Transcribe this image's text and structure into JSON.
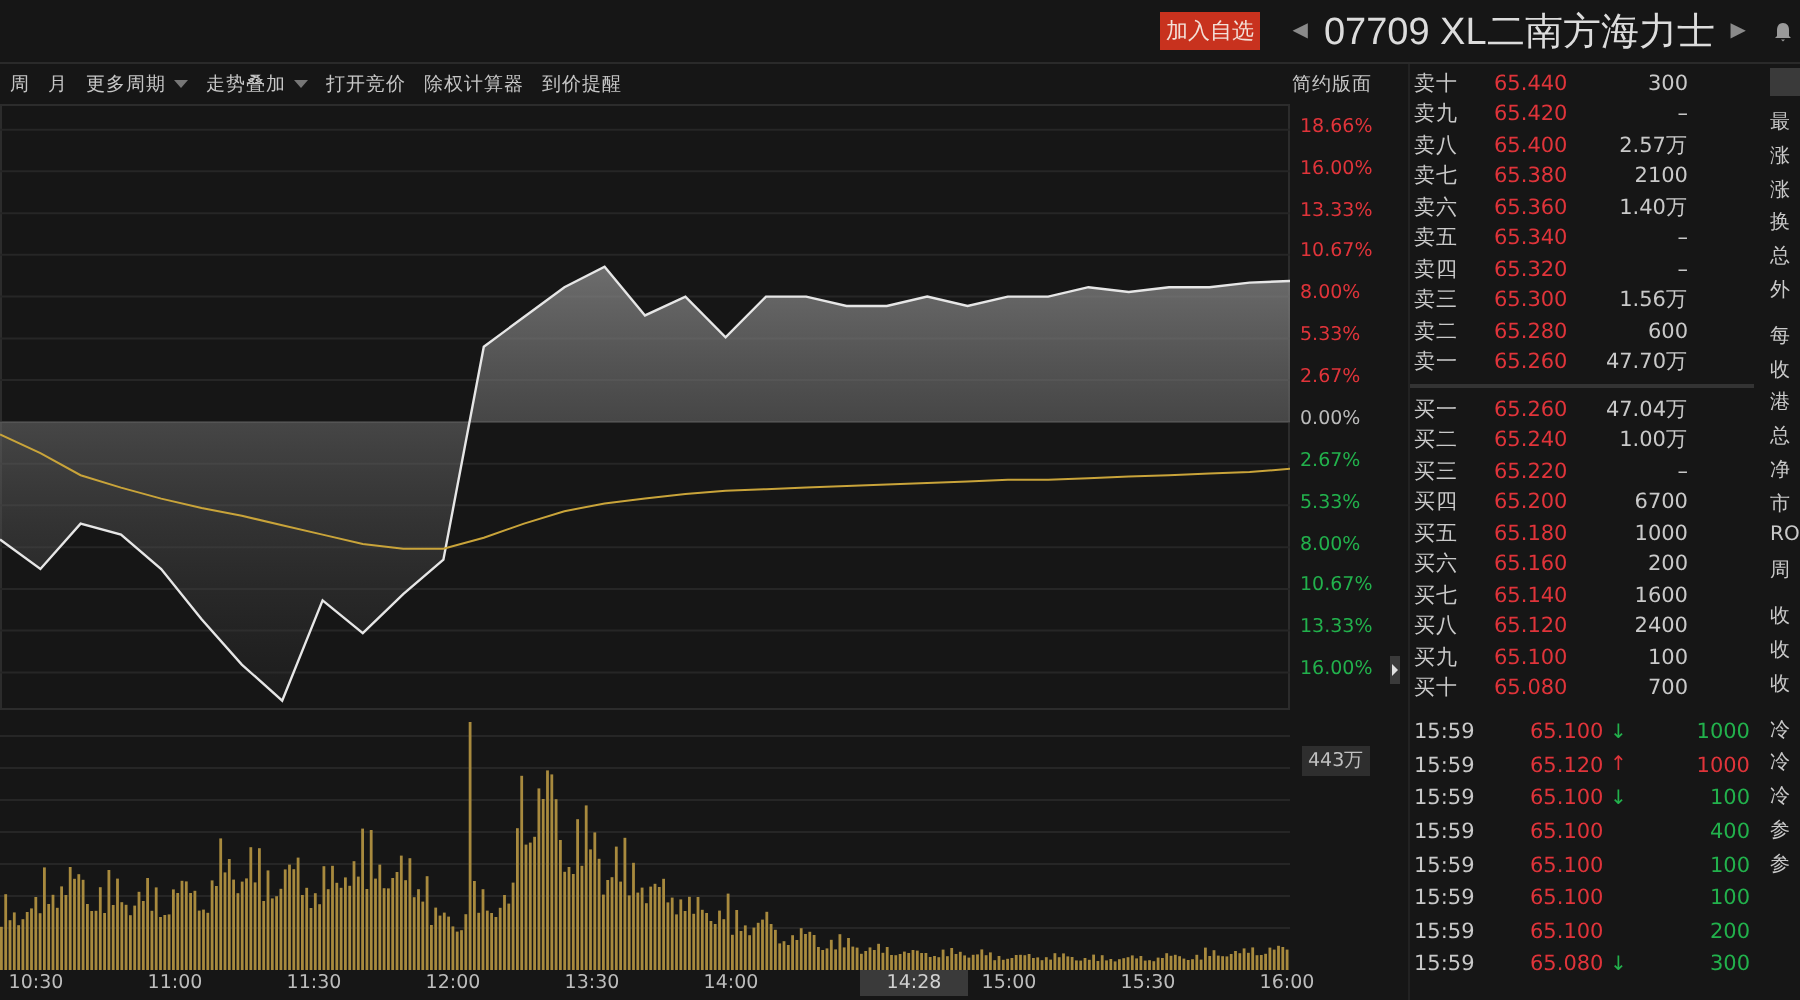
{
  "header": {
    "watch_button": "加入自选",
    "prev": "◀",
    "title": "07709 XL二南方海力士",
    "next": "▶"
  },
  "toolbar": {
    "items": [
      {
        "label": "周",
        "dropdown": false
      },
      {
        "label": "月",
        "dropdown": false
      },
      {
        "label": "更多周期",
        "dropdown": true
      },
      {
        "label": "走势叠加",
        "dropdown": true
      },
      {
        "label": "打开竞价",
        "dropdown": false
      },
      {
        "label": "除权计算器",
        "dropdown": false
      },
      {
        "label": "到价提醒",
        "dropdown": false
      }
    ],
    "layout_toggle": "简约版面"
  },
  "price_chart": {
    "chart_data": {
      "type": "area",
      "grid": true,
      "ylim": [
        -18.4,
        20.3
      ],
      "yticks": [
        {
          "value": 18.66,
          "label": "18.66%"
        },
        {
          "value": 16,
          "label": "16.00%"
        },
        {
          "value": 13.33,
          "label": "13.33%"
        },
        {
          "value": 10.67,
          "label": "10.67%"
        },
        {
          "value": 8,
          "label": "8.00%"
        },
        {
          "value": 5.33,
          "label": "5.33%"
        },
        {
          "value": 2.67,
          "label": "2.67%"
        },
        {
          "value": 0,
          "label": "0.00%"
        },
        {
          "value": -2.67,
          "label": "2.67%"
        },
        {
          "value": -5.33,
          "label": "5.33%"
        },
        {
          "value": -8,
          "label": "8.00%"
        },
        {
          "value": -10.67,
          "label": "10.67%"
        },
        {
          "value": -13.33,
          "label": "13.33%"
        },
        {
          "value": -16,
          "label": "16.00%"
        }
      ],
      "series": [
        {
          "type": "area",
          "color": "#e6e6e6",
          "values": [
            -7.5,
            -9.4,
            -6.5,
            -7.2,
            -9.4,
            -12.6,
            -15.5,
            -17.8,
            -11.4,
            -13.5,
            -11.0,
            -8.8,
            4.8,
            6.7,
            8.6,
            9.9,
            6.8,
            8.0,
            5.4,
            8.0,
            8.0,
            7.4,
            7.4,
            8.0,
            7.4,
            8.0,
            8.0,
            8.6,
            8.3,
            8.6,
            8.6,
            8.9,
            9.0
          ]
        },
        {
          "type": "line",
          "color": "#c9a43a",
          "values": [
            -0.8,
            -2.0,
            -3.4,
            -4.2,
            -4.9,
            -5.5,
            -6.0,
            -6.6,
            -7.2,
            -7.8,
            -8.1,
            -8.1,
            -7.4,
            -6.5,
            -5.7,
            -5.2,
            -4.9,
            -4.6,
            -4.4,
            -4.3,
            -4.2,
            -4.1,
            -4.0,
            -3.9,
            -3.8,
            -3.7,
            -3.7,
            -3.6,
            -3.5,
            -3.4,
            -3.3,
            -3.2,
            -3.0
          ]
        }
      ]
    }
  },
  "volume": {
    "max_label": "443万"
  },
  "time_axis": {
    "labels": [
      {
        "text": "10:30",
        "kind": "tick"
      },
      {
        "text": "11:00",
        "kind": "tick"
      },
      {
        "text": "11:30",
        "kind": "tick"
      },
      {
        "text": "12:00",
        "kind": "tick"
      },
      {
        "text": "13:30",
        "kind": "tick"
      },
      {
        "text": "14:00",
        "kind": "tick"
      },
      {
        "text": "14:28",
        "kind": "cursor"
      },
      {
        "text": "15:00",
        "kind": "tick"
      },
      {
        "text": "15:30",
        "kind": "tick"
      },
      {
        "text": "16:00",
        "kind": "tick"
      }
    ]
  },
  "order_book": {
    "asks": [
      {
        "label": "卖十",
        "price": "65.440",
        "volume": "300"
      },
      {
        "label": "卖九",
        "price": "65.420",
        "volume": "–"
      },
      {
        "label": "卖八",
        "price": "65.400",
        "volume": "2.57万"
      },
      {
        "label": "卖七",
        "price": "65.380",
        "volume": "2100"
      },
      {
        "label": "卖六",
        "price": "65.360",
        "volume": "1.40万"
      },
      {
        "label": "卖五",
        "price": "65.340",
        "volume": "–"
      },
      {
        "label": "卖四",
        "price": "65.320",
        "volume": "–"
      },
      {
        "label": "卖三",
        "price": "65.300",
        "volume": "1.56万"
      },
      {
        "label": "卖二",
        "price": "65.280",
        "volume": "600"
      },
      {
        "label": "卖一",
        "price": "65.260",
        "volume": "47.70万"
      }
    ],
    "bids": [
      {
        "label": "买一",
        "price": "65.260",
        "volume": "47.04万"
      },
      {
        "label": "买二",
        "price": "65.240",
        "volume": "1.00万"
      },
      {
        "label": "买三",
        "price": "65.220",
        "volume": "–"
      },
      {
        "label": "买四",
        "price": "65.200",
        "volume": "6700"
      },
      {
        "label": "买五",
        "price": "65.180",
        "volume": "1000"
      },
      {
        "label": "买六",
        "price": "65.160",
        "volume": "200"
      },
      {
        "label": "买七",
        "price": "65.140",
        "volume": "1600"
      },
      {
        "label": "买八",
        "price": "65.120",
        "volume": "2400"
      },
      {
        "label": "买九",
        "price": "65.100",
        "volume": "100"
      },
      {
        "label": "买十",
        "price": "65.080",
        "volume": "700"
      }
    ]
  },
  "trades": [
    {
      "time": "15:59",
      "price": "65.100",
      "arrow": "↓",
      "up": false,
      "volume": "1000"
    },
    {
      "time": "15:59",
      "price": "65.120",
      "arrow": "↑",
      "up": true,
      "volume": "1000"
    },
    {
      "time": "15:59",
      "price": "65.100",
      "arrow": "↓",
      "up": false,
      "volume": "100"
    },
    {
      "time": "15:59",
      "price": "65.100",
      "up": false,
      "volume": "400"
    },
    {
      "time": "15:59",
      "price": "65.100",
      "up": false,
      "volume": "100"
    },
    {
      "time": "15:59",
      "price": "65.100",
      "up": false,
      "volume": "100"
    },
    {
      "time": "15:59",
      "price": "65.100",
      "up": false,
      "volume": "200"
    },
    {
      "time": "15:59",
      "price": "65.080",
      "arrow": "↓",
      "up": false,
      "volume": "300"
    }
  ],
  "stats_panel": {
    "groups": [
      [
        "最",
        "涨",
        "涨",
        "换",
        "总",
        "外"
      ],
      [
        "每",
        "收",
        "港",
        "总",
        "净",
        "市",
        "RO",
        "周"
      ],
      [
        "收",
        "收",
        "收"
      ],
      [
        "冷",
        "冷",
        "冷",
        "参",
        "参"
      ]
    ]
  }
}
